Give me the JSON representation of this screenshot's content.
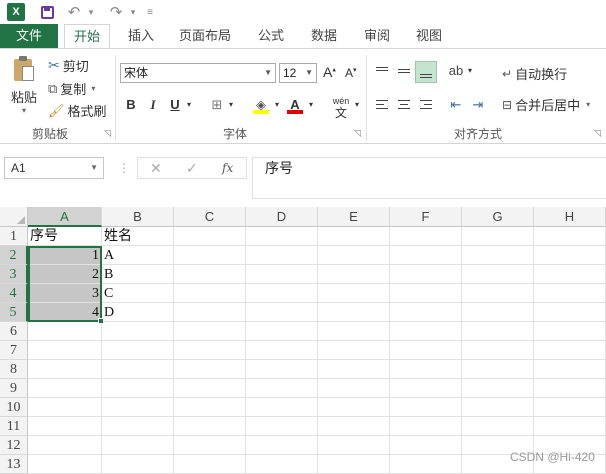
{
  "qat": {
    "app_icon": "excel-logo",
    "icons": [
      "save-icon",
      "undo-icon",
      "redo-icon",
      "customize-icon"
    ]
  },
  "tabs": [
    "文件",
    "开始",
    "插入",
    "页面布局",
    "公式",
    "数据",
    "审阅",
    "视图"
  ],
  "ribbon": {
    "clipboard": {
      "paste": "粘贴",
      "cut": "剪切",
      "copy": "复制",
      "format_painter": "格式刷",
      "label": "剪贴板"
    },
    "font": {
      "family": "宋体",
      "size": "12",
      "bold": "B",
      "italic": "I",
      "underline": "U",
      "pinyin": "wén",
      "label": "字体"
    },
    "alignment": {
      "wrap_text": "自动换行",
      "merge_center": "合并后居中",
      "label": "对齐方式"
    }
  },
  "formula_bar": {
    "name_box": "A1",
    "formula": "序号",
    "cancel": "✕",
    "enter": "✓",
    "fx": "fx"
  },
  "sheet": {
    "columns": [
      "A",
      "B",
      "C",
      "D",
      "E",
      "F",
      "G",
      "H"
    ],
    "rows": [
      "1",
      "2",
      "3",
      "4",
      "5",
      "6",
      "7",
      "8",
      "9",
      "10",
      "11",
      "12",
      "13"
    ],
    "cells": {
      "A1": "序号",
      "B1": "姓名",
      "A2": "1",
      "B2": "A",
      "A3": "2",
      "B3": "B",
      "A4": "3",
      "B4": "C",
      "A5": "4",
      "B5": "D"
    }
  },
  "watermark": "CSDN @Hi-420"
}
